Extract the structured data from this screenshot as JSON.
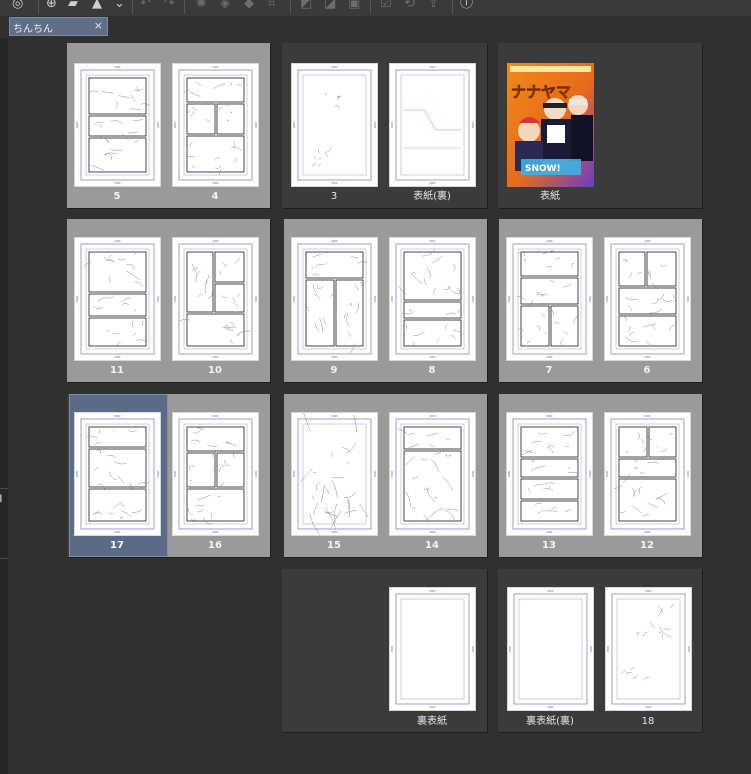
{
  "document_tab": {
    "title": "ちんちん",
    "close_glyph": "×"
  },
  "toolbar": {
    "icons": [
      "app-logo-icon",
      "new-file-icon",
      "open-folder-icon",
      "save-icon",
      "undo-icon",
      "redo-icon",
      "transform-icon",
      "fill-icon",
      "ruler-icon",
      "crop-icon",
      "grid-icon",
      "brush-icon",
      "check-icon",
      "lasso-icon",
      "export-icon",
      "help-icon"
    ]
  },
  "spreads": [
    {
      "id": "s1",
      "pages": [
        {
          "label": "5",
          "panels": "A"
        },
        {
          "label": "4",
          "panels": "B"
        }
      ]
    },
    {
      "id": "s2",
      "pages": [
        {
          "label": "3",
          "panels": "C"
        },
        {
          "label": "表紙(裏)",
          "panels": "D"
        }
      ]
    },
    {
      "id": "s3",
      "pages": [
        {
          "label": "表紙",
          "panels": "COVER"
        }
      ]
    },
    {
      "id": "s4",
      "pages": [
        {
          "label": "11",
          "panels": "E"
        },
        {
          "label": "10",
          "panels": "F"
        }
      ]
    },
    {
      "id": "s5",
      "pages": [
        {
          "label": "9",
          "panels": "G"
        },
        {
          "label": "8",
          "panels": "H"
        }
      ]
    },
    {
      "id": "s6",
      "pages": [
        {
          "label": "7",
          "panels": "I"
        },
        {
          "label": "6",
          "panels": "J"
        }
      ]
    },
    {
      "id": "s7",
      "pages": [
        {
          "label": "17",
          "panels": "K"
        },
        {
          "label": "16",
          "panels": "L"
        }
      ]
    },
    {
      "id": "s8",
      "pages": [
        {
          "label": "15",
          "panels": "M"
        },
        {
          "label": "14",
          "panels": "N"
        }
      ]
    },
    {
      "id": "s9",
      "pages": [
        {
          "label": "13",
          "panels": "O"
        },
        {
          "label": "12",
          "panels": "P"
        }
      ]
    },
    {
      "id": "s10",
      "pages": [
        {
          "label": "裏表紙",
          "panels": "BLANK"
        }
      ]
    },
    {
      "id": "s11",
      "pages": [
        {
          "label": "裏表紙(裏)",
          "panels": "BLANK"
        },
        {
          "label": "18",
          "panels": "Q"
        }
      ]
    }
  ],
  "selected_page": "17",
  "colors": {
    "selected": "#5c6b85",
    "spread_bg": "#9a9a9a",
    "guide": "#5a5ab4"
  }
}
